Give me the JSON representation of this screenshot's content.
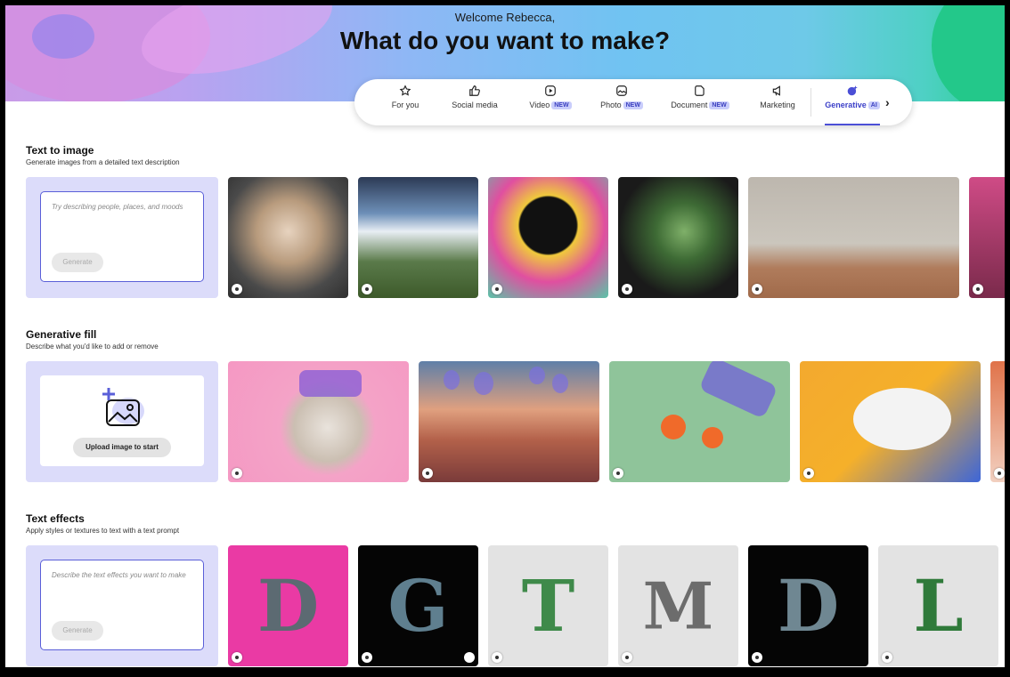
{
  "header": {
    "greeting": "Welcome Rebecca,",
    "headline": "What do you want to make?"
  },
  "tabs": [
    {
      "label": "For you",
      "icon": "star-icon",
      "badge": ""
    },
    {
      "label": "Social media",
      "icon": "thumbs-up-icon",
      "badge": ""
    },
    {
      "label": "Video",
      "icon": "play-icon",
      "badge": "NEW"
    },
    {
      "label": "Photo",
      "icon": "photo-icon",
      "badge": "NEW"
    },
    {
      "label": "Document",
      "icon": "document-icon",
      "badge": "NEW"
    },
    {
      "label": "Marketing",
      "icon": "megaphone-icon",
      "badge": ""
    },
    {
      "label": "Generative",
      "icon": "sparkle-icon",
      "badge": "AI",
      "active": true
    }
  ],
  "sections": {
    "text_to_image": {
      "title": "Text to image",
      "subtitle": "Generate images from a detailed text description",
      "placeholder": "Try describing people, places, and moods",
      "button": "Generate"
    },
    "generative_fill": {
      "title": "Generative fill",
      "subtitle": "Describe what you'd like to add or remove",
      "button": "Upload image to start"
    },
    "text_effects": {
      "title": "Text effects",
      "subtitle": "Apply styles or textures to text with a text prompt",
      "placeholder": "Describe the text effects you want to make",
      "button": "Generate",
      "letters": [
        "D",
        "G",
        "T",
        "M",
        "D",
        "L"
      ]
    }
  },
  "colors": {
    "accent": "#4b4fd6",
    "panel": "#dcdcfa"
  }
}
